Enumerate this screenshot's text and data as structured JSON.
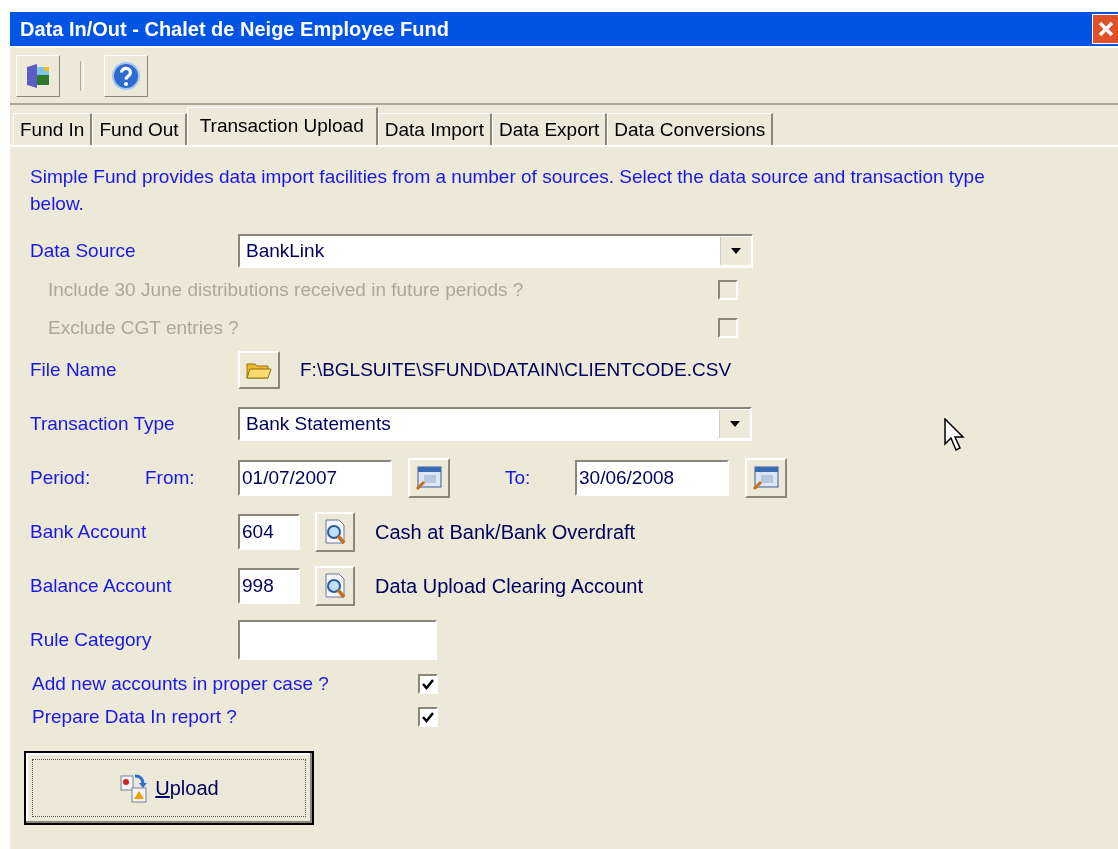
{
  "window": {
    "title": "Data In/Out - Chalet de Neige Employee Fund"
  },
  "tabs": [
    {
      "label": "Fund In",
      "selected": false
    },
    {
      "label": "Fund Out",
      "selected": false
    },
    {
      "label": "Transaction Upload",
      "selected": true
    },
    {
      "label": "Data Import",
      "selected": false
    },
    {
      "label": "Data Export",
      "selected": false
    },
    {
      "label": "Data Conversions",
      "selected": false
    }
  ],
  "intro": "Simple Fund provides data import facilities from a number of sources. Select the data source and transaction type below.",
  "data_source": {
    "label": "Data Source",
    "value": "BankLink"
  },
  "source_options": [
    {
      "label": "Include 30 June distributions received in future periods ?",
      "checked": false,
      "disabled": true
    },
    {
      "label": "Exclude CGT entries ?",
      "checked": false,
      "disabled": true
    }
  ],
  "file_name": {
    "label": "File Name",
    "value": "F:\\BGLSUITE\\SFUND\\DATAIN\\CLIENTCODE.CSV"
  },
  "transaction_type": {
    "label": "Transaction Type",
    "value": "Bank Statements"
  },
  "period": {
    "label": "Period:",
    "from_label": "From:",
    "from_value": "01/07/2007",
    "to_label": "To:",
    "to_value": "30/06/2008"
  },
  "accounts": [
    {
      "label": "Bank Account",
      "code": "604",
      "description": "Cash at Bank/Bank Overdraft"
    },
    {
      "label": "Balance Account",
      "code": "998",
      "description": "Data Upload Clearing Account"
    }
  ],
  "rule_category": {
    "label": "Rule Category"
  },
  "flags": [
    {
      "label": "Add new accounts in proper case ?",
      "checked": true
    },
    {
      "label": "Prepare Data In report ?",
      "checked": true
    }
  ],
  "upload_button": {
    "label": "Upload"
  }
}
